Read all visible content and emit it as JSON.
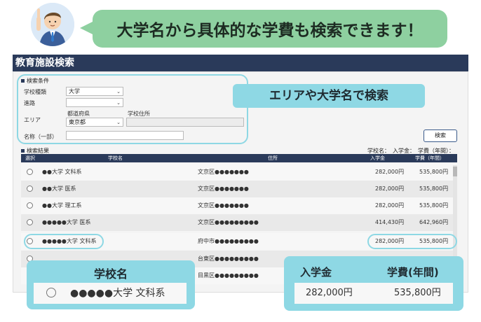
{
  "banner": {
    "text": "大学名から具体的な学費も検索できます！"
  },
  "window": {
    "title": "教育施設検索"
  },
  "conditions": {
    "section_label": "検索条件",
    "school_type_label": "学校種類",
    "school_type_value": "大学",
    "course_label": "進路",
    "course_value": "",
    "area_label": "エリア",
    "prefecture_label": "都道府県",
    "prefecture_value": "東京都",
    "address_label": "学校住所",
    "address_value": "",
    "name_label": "名称（一部）",
    "name_value": "",
    "search_button": "検索"
  },
  "callouts": {
    "area": "エリアや大学名で検索",
    "name_title": "学校名",
    "name_example": "●●●●●大学 文科系",
    "fee_title_entry": "入学金",
    "fee_title_tuition": "学費(年間)",
    "fee_entry": "282,000円",
    "fee_tuition": "535,800円"
  },
  "results": {
    "section_label": "検索結果",
    "summary": "学校名：　入学金：　学費（年間）：",
    "columns": {
      "select": "選択",
      "name": "学校名",
      "address": "住所",
      "entry": "入学金",
      "tuition": "学費（年間）"
    },
    "rows": [
      {
        "name": "●●大学 文科系",
        "address": "文京区●●●●●●●",
        "entry": "282,000円",
        "tuition": "535,800円"
      },
      {
        "name": "●●大学 医系",
        "address": "文京区●●●●●●●",
        "entry": "282,000円",
        "tuition": "535,800円"
      },
      {
        "name": "●●大学 理工系",
        "address": "文京区●●●●●●●",
        "entry": "282,000円",
        "tuition": "535,800円"
      },
      {
        "name": "●●●●●大学 医系",
        "address": "文京区●●●●●●●●●",
        "entry": "414,430円",
        "tuition": "642,960円"
      },
      {
        "name": "●●●●●大学 文科系",
        "address": "府中市●●●●●●●●●",
        "entry": "282,000円",
        "tuition": "535,800円"
      },
      {
        "name": "",
        "address": "台東区●●●●●●●●●",
        "entry": "",
        "tuition": ""
      },
      {
        "name": "",
        "address": "目黒区●●●●●●●●●",
        "entry": "",
        "tuition": ""
      }
    ]
  },
  "colors": {
    "titlebar": "#2a3a5a",
    "accent": "#8ed8e4",
    "speech": "#8ed0a0"
  },
  "icons": {
    "avatar": "businessman-pointing-icon",
    "dropdown": "chevron-down-icon",
    "radio": "radio-icon"
  }
}
